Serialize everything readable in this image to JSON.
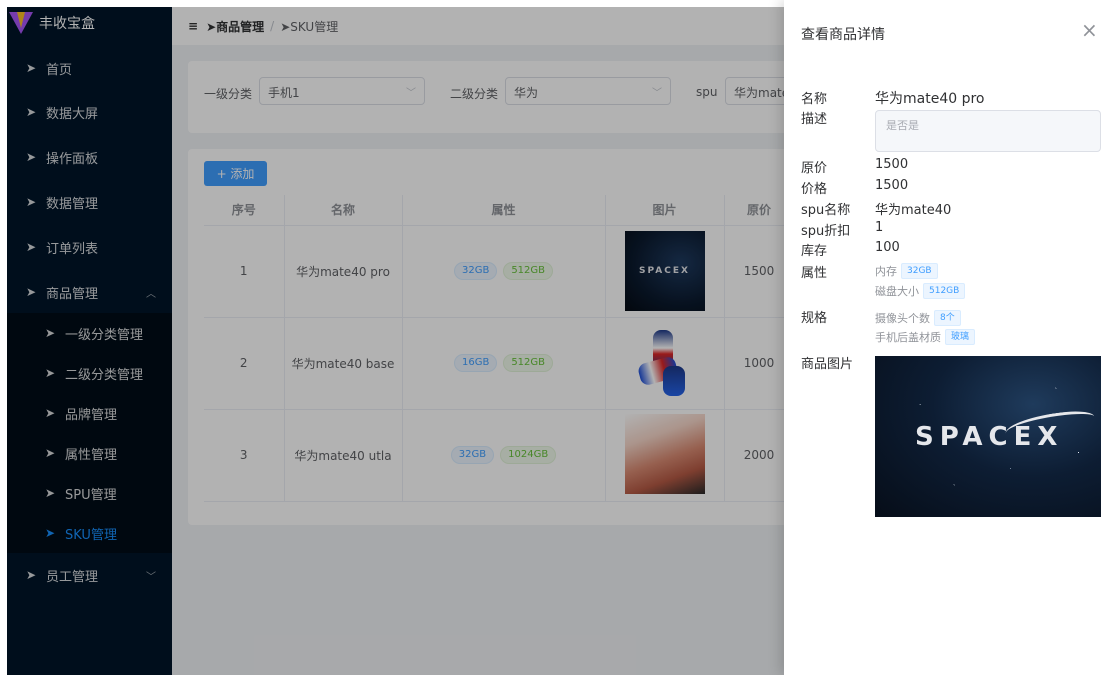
{
  "sidebar": {
    "logo_text": "丰收宝盒",
    "items": [
      {
        "label": "首页"
      },
      {
        "label": "数据大屏"
      },
      {
        "label": "操作面板"
      },
      {
        "label": "数据管理"
      },
      {
        "label": "订单列表"
      },
      {
        "label": "商品管理",
        "expanded": true
      },
      {
        "label": "一级分类管理"
      },
      {
        "label": "二级分类管理"
      },
      {
        "label": "品牌管理"
      },
      {
        "label": "属性管理"
      },
      {
        "label": "SPU管理"
      },
      {
        "label": "SKU管理",
        "active": true
      },
      {
        "label": "员工管理",
        "expanded": false
      }
    ]
  },
  "breadcrumb": {
    "level1": "商品管理",
    "sep": "/",
    "level2": "SKU管理"
  },
  "filters": {
    "cat1_label": "一级分类",
    "cat1_value": "手机1",
    "cat2_label": "二级分类",
    "cat2_value": "华为",
    "spu_label": "spu",
    "spu_value": "华为mate"
  },
  "toolbar": {
    "add_label": "+ 添加"
  },
  "table": {
    "columns": [
      "序号",
      "名称",
      "属性",
      "图片",
      "原价"
    ],
    "rows": [
      {
        "index": "1",
        "name": "华为mate40 pro",
        "tags": [
          "32GB",
          "512GB"
        ],
        "image_text": "SPACEX",
        "price": "1500"
      },
      {
        "index": "2",
        "name": "华为mate40 base",
        "tags": [
          "16GB",
          "512GB"
        ],
        "price": "1000"
      },
      {
        "index": "3",
        "name": "华为mate40 utla",
        "tags": [
          "32GB",
          "1024GB"
        ],
        "price": "2000"
      }
    ]
  },
  "drawer": {
    "title": "查看商品详情",
    "fields": {
      "name_label": "名称",
      "name_value": "华为mate40 pro",
      "desc_label": "描述",
      "desc_value": "是否是",
      "orig_price_label": "原价",
      "orig_price_value": "1500",
      "price_label": "价格",
      "price_value": "1500",
      "spu_name_label": "spu名称",
      "spu_name_value": "华为mate40",
      "spu_discount_label": "spu折扣",
      "spu_discount_value": "1",
      "stock_label": "库存",
      "stock_value": "100",
      "attr_label": "属性",
      "attrs": [
        {
          "name": "内存",
          "value": "32GB"
        },
        {
          "name": "磁盘大小",
          "value": "512GB"
        }
      ],
      "spec_label": "规格",
      "specs": [
        {
          "name": "摄像头个数",
          "value": "8个"
        },
        {
          "name": "手机后盖材质",
          "value": "玻璃"
        }
      ],
      "image_label": "商品图片",
      "image_text": "SPACEX"
    }
  },
  "colors": {
    "sidebar_bg": "#001529",
    "active": "#1890ff",
    "primary": "#409eff"
  }
}
